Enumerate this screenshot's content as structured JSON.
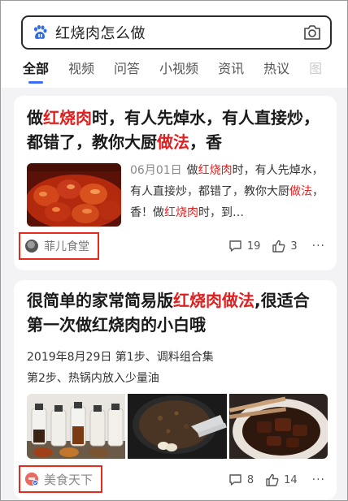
{
  "search": {
    "query": "红烧肉怎么做"
  },
  "tabs": [
    {
      "label": "全部",
      "active": true
    },
    {
      "label": "视频"
    },
    {
      "label": "问答"
    },
    {
      "label": "小视频"
    },
    {
      "label": "资讯"
    },
    {
      "label": "热议"
    },
    {
      "label": "图"
    }
  ],
  "results": [
    {
      "title_parts": [
        {
          "text": "做",
          "hl": false
        },
        {
          "text": "红烧肉",
          "hl": true
        },
        {
          "text": "时，有人先焯水，有人直接炒，都错了，教你大厨",
          "hl": false
        },
        {
          "text": "做法",
          "hl": true
        },
        {
          "text": "，香",
          "hl": false
        }
      ],
      "date": "06月01日",
      "snippet_parts": [
        {
          "text": "做",
          "hl": false
        },
        {
          "text": "红烧肉",
          "hl": true
        },
        {
          "text": "时，有人先焯水，有人直接炒，都错了，教你大厨",
          "hl": false
        },
        {
          "text": "做法",
          "hl": true
        },
        {
          "text": "，香！做",
          "hl": false
        },
        {
          "text": "红烧肉",
          "hl": true
        },
        {
          "text": "时，到…",
          "hl": false
        }
      ],
      "source": "菲儿食堂",
      "comments": "19",
      "likes": "3",
      "more": "···"
    },
    {
      "title_parts": [
        {
          "text": "很简单的家常简易版",
          "hl": false
        },
        {
          "text": "红烧肉做法",
          "hl": true
        },
        {
          "text": ",很适合第一次做红烧肉的小白哦",
          "hl": false
        }
      ],
      "line1": "2019年8月29日  第1步、调料组合集",
      "line2": "第2步、热锅内放入少量油",
      "source": "美食天下",
      "comments": "8",
      "likes": "14",
      "more": "···"
    }
  ],
  "colors": {
    "highlight": "#e02020",
    "accent": "#3a6cf4",
    "source_box": "#e8291c"
  },
  "icons": {
    "search_logo": "baidu-paw-icon",
    "camera": "camera-icon",
    "comment": "comment-icon",
    "like": "thumbs-up-icon"
  }
}
